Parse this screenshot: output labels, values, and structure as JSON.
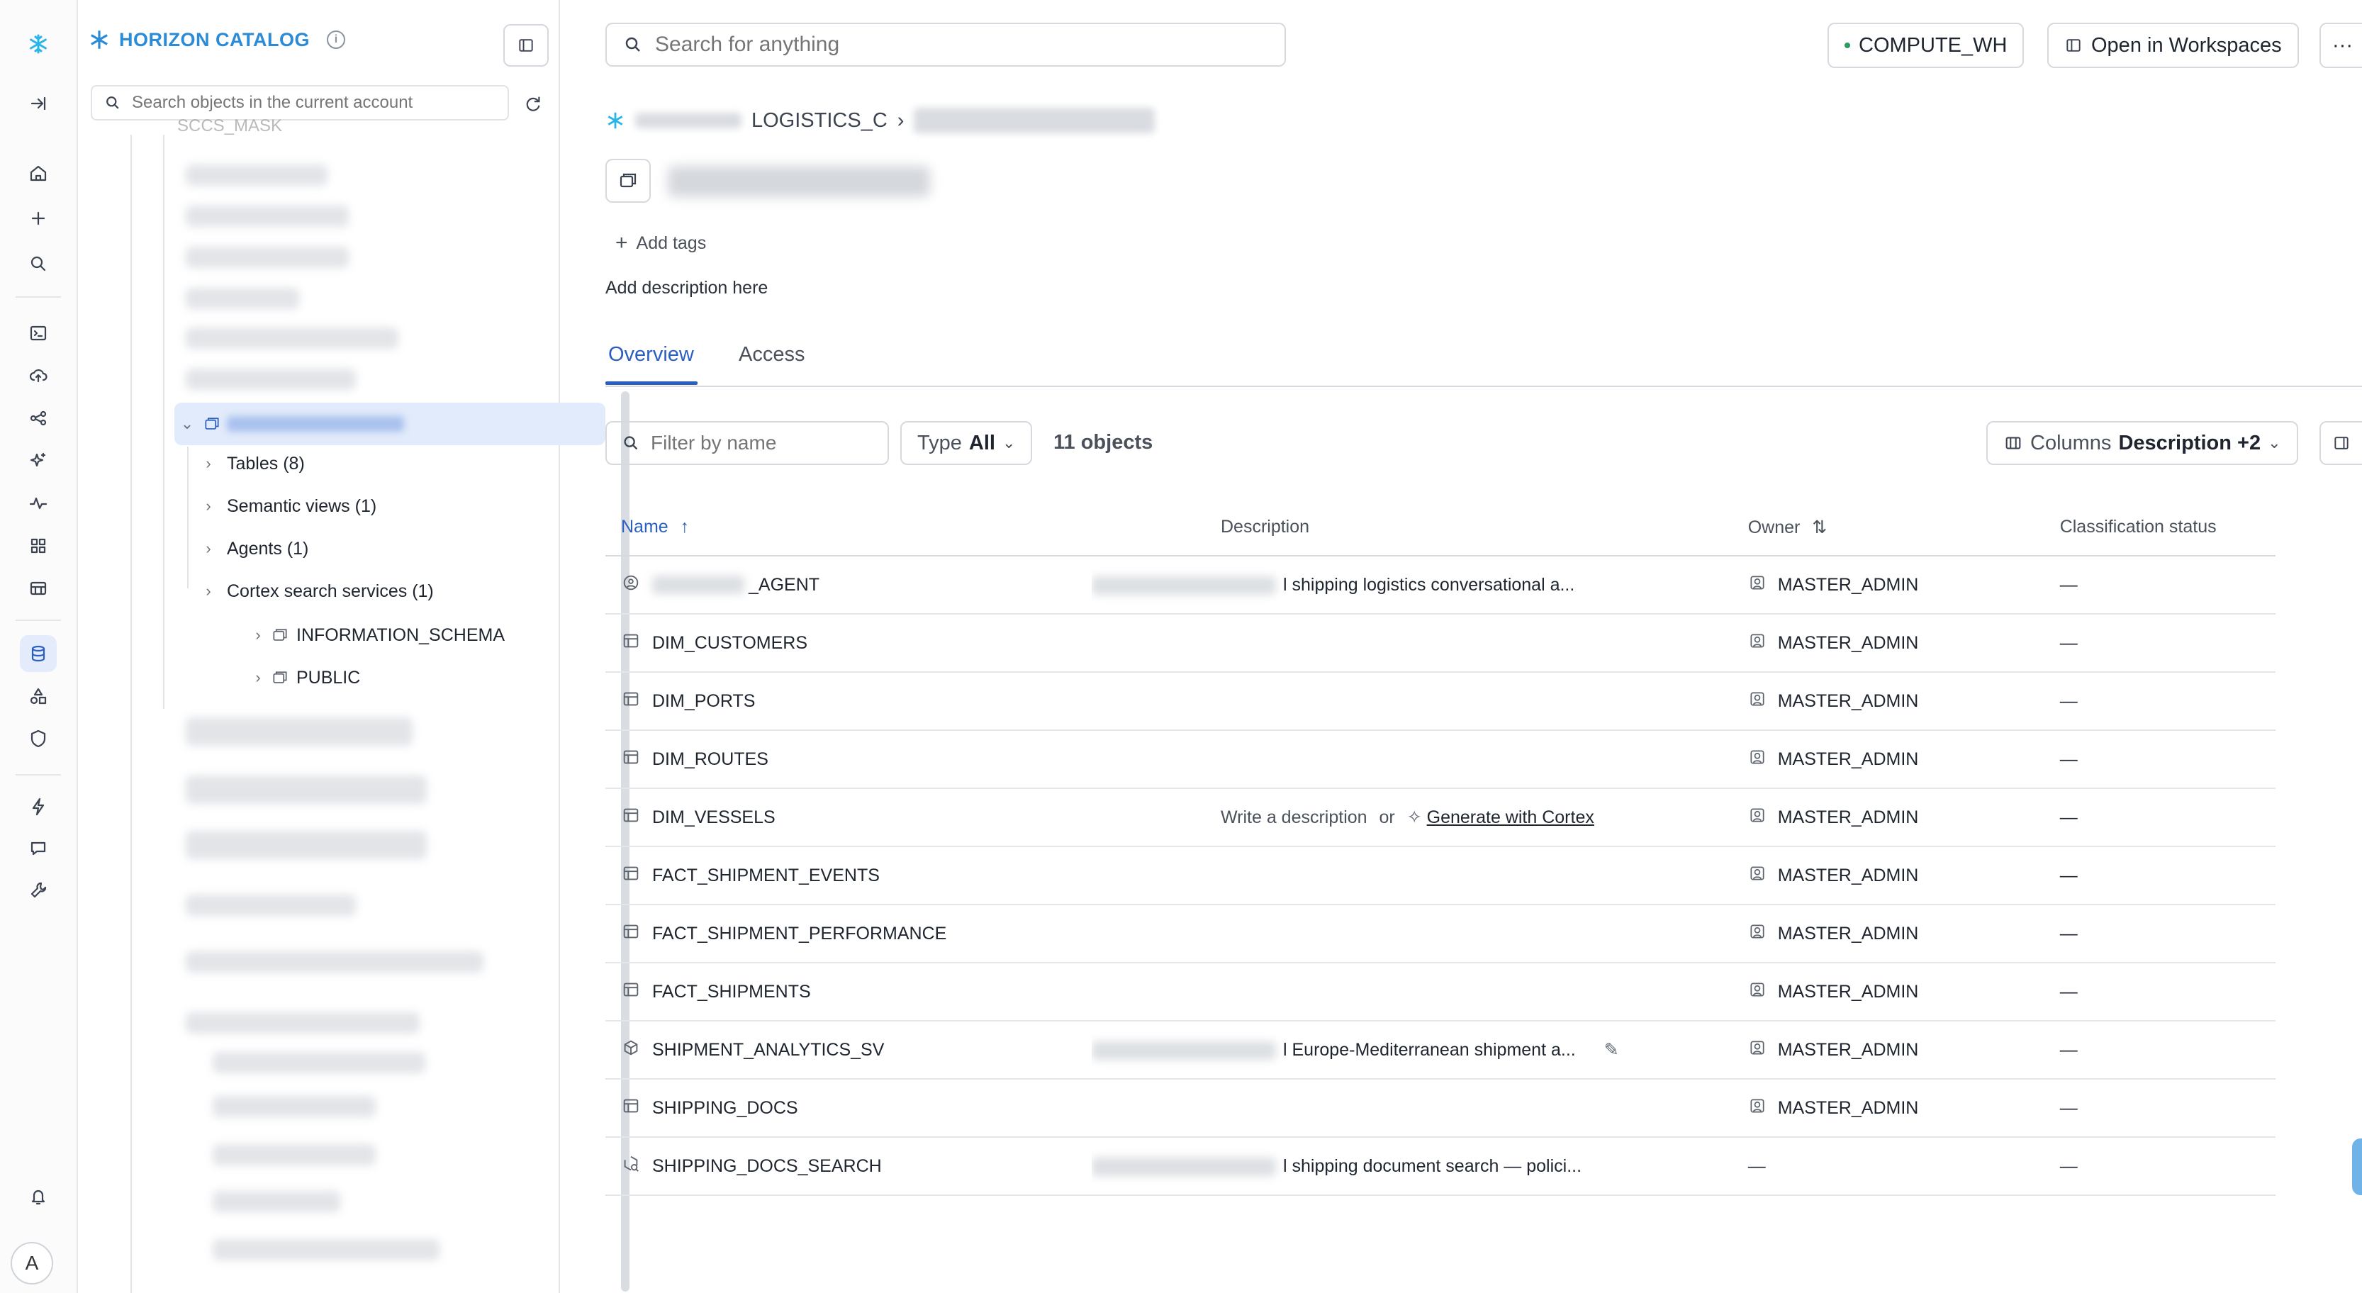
{
  "rail": {
    "avatar_letter": "A",
    "icons": [
      "snowflake-logo",
      "expand-icon",
      "home-icon",
      "plus-icon",
      "search-icon",
      "terminal-icon",
      "cloud-upload-icon",
      "graph-icon",
      "sparkle-icon",
      "activity-icon",
      "grid-icon",
      "marketplace-icon",
      "database-icon",
      "shapes-icon",
      "shield-icon",
      "bolt-icon",
      "chat-icon",
      "wrench-icon",
      "bell-icon"
    ]
  },
  "catalog": {
    "title": "HORIZON CATALOG",
    "search_placeholder": "Search objects in the current account",
    "partial_item": "SCCS_MASK",
    "children": [
      {
        "label": "Tables (8)"
      },
      {
        "label": "Semantic views (1)"
      },
      {
        "label": "Agents (1)"
      },
      {
        "label": "Cortex search services (1)"
      }
    ],
    "schemas": [
      {
        "label": "INFORMATION_SCHEMA"
      },
      {
        "label": "PUBLIC"
      }
    ]
  },
  "topbar": {
    "search_placeholder": "Search for anything",
    "warehouse": "COMPUTE_WH",
    "open_workspaces": "Open in Workspaces",
    "more": "···"
  },
  "header": {
    "breadcrumb_db": "LOGISTICS_C",
    "breadcrumb_sep": "›",
    "add_tags": "Add tags",
    "add_description": "Add description here"
  },
  "tabs": [
    {
      "label": "Overview",
      "active": true
    },
    {
      "label": "Access",
      "active": false
    }
  ],
  "toolbar": {
    "filter_placeholder": "Filter by name",
    "type_label": "Type",
    "type_value": "All",
    "count": "11 objects",
    "columns_label": "Columns",
    "columns_value": "Description +2"
  },
  "table": {
    "headers": {
      "name": "Name",
      "description": "Description",
      "owner": "Owner",
      "classification": "Classification status"
    },
    "rows": [
      {
        "name": "_AGENT",
        "icon": "agent",
        "desc": "l shipping logistics conversational a...",
        "desc_blur": true,
        "owner": "MASTER_ADMIN",
        "status": "—"
      },
      {
        "name": "DIM_CUSTOMERS",
        "icon": "table",
        "desc": "",
        "owner": "MASTER_ADMIN",
        "status": "—"
      },
      {
        "name": "DIM_PORTS",
        "icon": "table",
        "desc": "",
        "owner": "MASTER_ADMIN",
        "status": "—"
      },
      {
        "name": "DIM_ROUTES",
        "icon": "table",
        "desc": "",
        "owner": "MASTER_ADMIN",
        "status": "—"
      },
      {
        "name": "DIM_VESSELS",
        "icon": "table",
        "desc": "",
        "write_desc": "Write a description",
        "or": "or",
        "generate": "Generate with Cortex",
        "owner": "MASTER_ADMIN",
        "status": "—"
      },
      {
        "name": "FACT_SHIPMENT_EVENTS",
        "icon": "table",
        "desc": "",
        "owner": "MASTER_ADMIN",
        "status": "—"
      },
      {
        "name": "FACT_SHIPMENT_PERFORMANCE",
        "icon": "table",
        "desc": "",
        "owner": "MASTER_ADMIN",
        "status": "—"
      },
      {
        "name": "FACT_SHIPMENTS",
        "icon": "table",
        "desc": "",
        "owner": "MASTER_ADMIN",
        "status": "—"
      },
      {
        "name": "SHIPMENT_ANALYTICS_SV",
        "icon": "semantic",
        "desc": "l Europe-Mediterranean shipment a...",
        "desc_blur": true,
        "edit": true,
        "owner": "MASTER_ADMIN",
        "status": "—"
      },
      {
        "name": "SHIPPING_DOCS",
        "icon": "table",
        "desc": "",
        "owner": "MASTER_ADMIN",
        "status": "—"
      },
      {
        "name": "SHIPPING_DOCS_SEARCH",
        "icon": "search-service",
        "desc": "l shipping document search — polici...",
        "desc_blur": true,
        "owner": "—",
        "owner_plain": true,
        "status": "—"
      }
    ]
  }
}
